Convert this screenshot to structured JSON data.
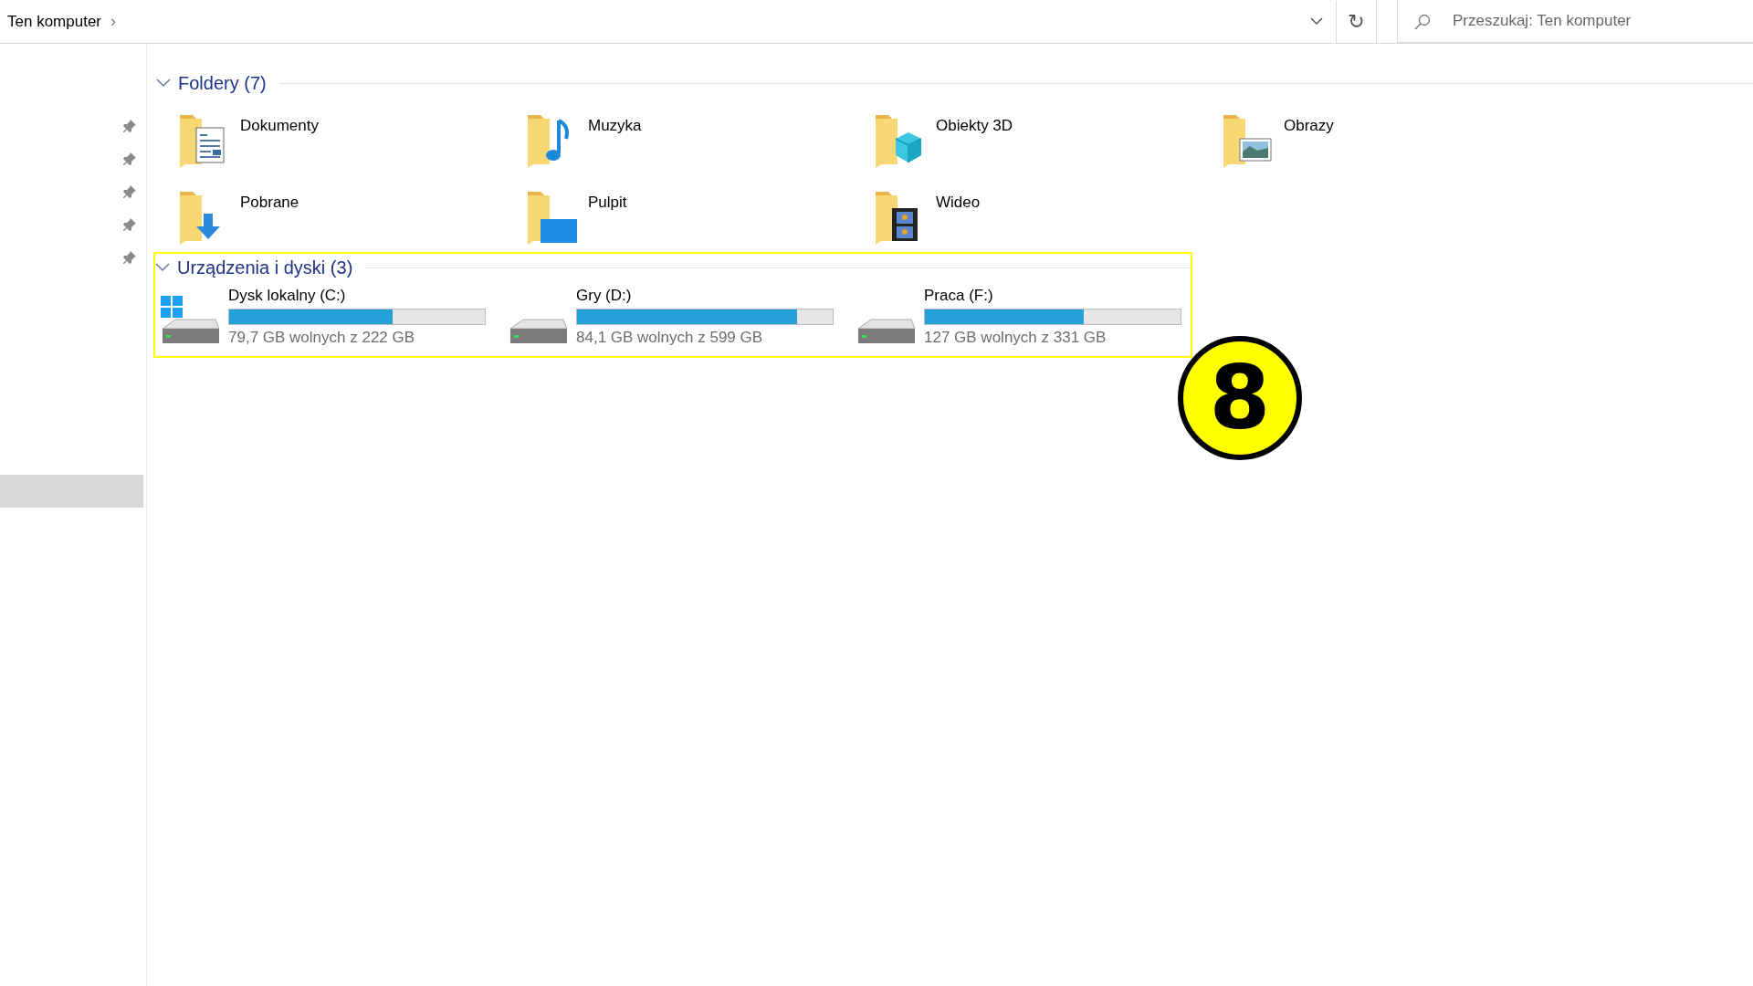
{
  "address_bar": {
    "path": "Ten komputer",
    "separator": "›",
    "refresh": "↻"
  },
  "search": {
    "placeholder": "Przeszukaj: Ten komputer"
  },
  "sidebar": {
    "pinned_count_items": [
      {
        "pinned": true
      },
      {
        "pinned": true
      },
      {
        "pinned": true
      },
      {
        "pinned": true
      },
      {
        "pinned": true
      }
    ],
    "selected_row": {
      "selected": true
    }
  },
  "folders": {
    "title": "Foldery (7)",
    "expanded": true,
    "items": [
      {
        "name": "Dokumenty"
      },
      {
        "name": "Muzyka"
      },
      {
        "name": "Obiekty 3D"
      },
      {
        "name": "Obrazy"
      },
      {
        "name": "Pobrane"
      },
      {
        "name": "Pulpit"
      },
      {
        "name": "Wideo"
      }
    ]
  },
  "drives": {
    "title": "Urządzenia i dyski (3)",
    "expanded": true,
    "highlighted": true,
    "items": [
      {
        "name": "Dysk lokalny (C:)",
        "level": 0.64,
        "free": "79,7 GB wolnych z 222 GB"
      },
      {
        "name": "Gry (D:)",
        "level": 0.86,
        "free": "84,1 GB wolnych z 599 GB"
      },
      {
        "name": "Praca (F:)",
        "level": 0.62,
        "free": "127 GB wolnych z 331 GB"
      }
    ]
  },
  "annotation": {
    "label": "8"
  }
}
